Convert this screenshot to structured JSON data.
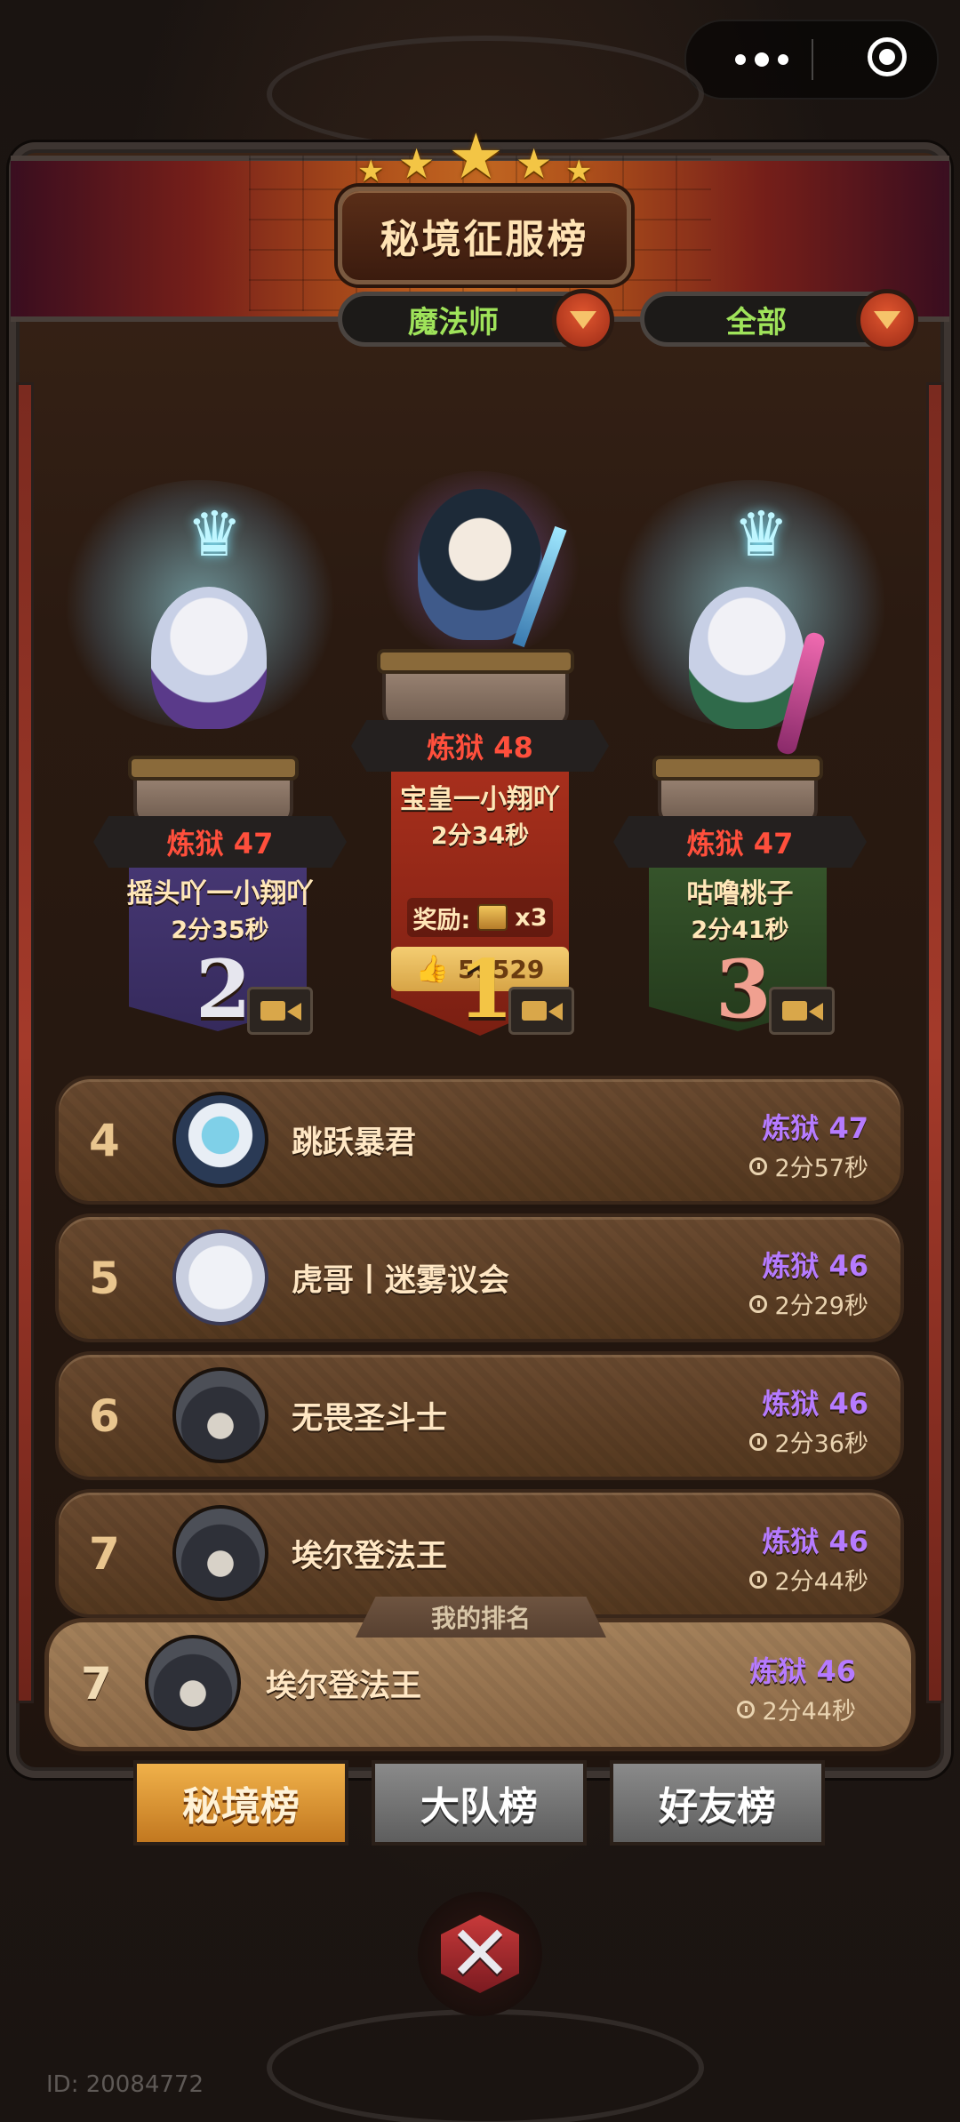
{
  "title": "秘境征服榜",
  "filters": {
    "class": "魔法师",
    "scope": "全部"
  },
  "podium": {
    "first": {
      "realm": "炼狱 48",
      "name": "宝皇一小翔吖",
      "time": "2分34秒",
      "reward_label": "奖励:",
      "reward_count": "x3",
      "likes": "59529",
      "rank": "1"
    },
    "second": {
      "realm": "炼狱 47",
      "name": "摇头吖一小翔吖",
      "time": "2分35秒",
      "rank": "2"
    },
    "third": {
      "realm": "炼狱 47",
      "name": "咕噜桃子",
      "time": "2分41秒",
      "rank": "3"
    }
  },
  "rows": [
    {
      "rank": "4",
      "name": "跳跃暴君",
      "realm": "炼狱 47",
      "time": "2分57秒"
    },
    {
      "rank": "5",
      "name": "虎哥丨迷雾议会",
      "realm": "炼狱 46",
      "time": "2分29秒"
    },
    {
      "rank": "6",
      "name": "无畏圣斗士",
      "realm": "炼狱 46",
      "time": "2分36秒"
    },
    {
      "rank": "7",
      "name": "埃尔登法王",
      "realm": "炼狱 46",
      "time": "2分44秒"
    }
  ],
  "my_rank": {
    "label": "我的排名",
    "rank": "7",
    "name": "埃尔登法王",
    "realm": "炼狱 46",
    "time": "2分44秒"
  },
  "tabs": [
    "秘境榜",
    "大队榜",
    "好友榜"
  ],
  "close_glyph": "✕",
  "footer_id": "ID: 20084772",
  "icons": [
    "more-icon",
    "close-capsule-icon",
    "dropdown-icon",
    "video-icon",
    "clock-icon",
    "thumb-up-icon",
    "chest-icon"
  ],
  "colors": {
    "realm_purple": "#b67bff",
    "realm_red": "#ff4f3c",
    "filter_green": "#9fe35a",
    "tab_active": "#e0992f"
  }
}
